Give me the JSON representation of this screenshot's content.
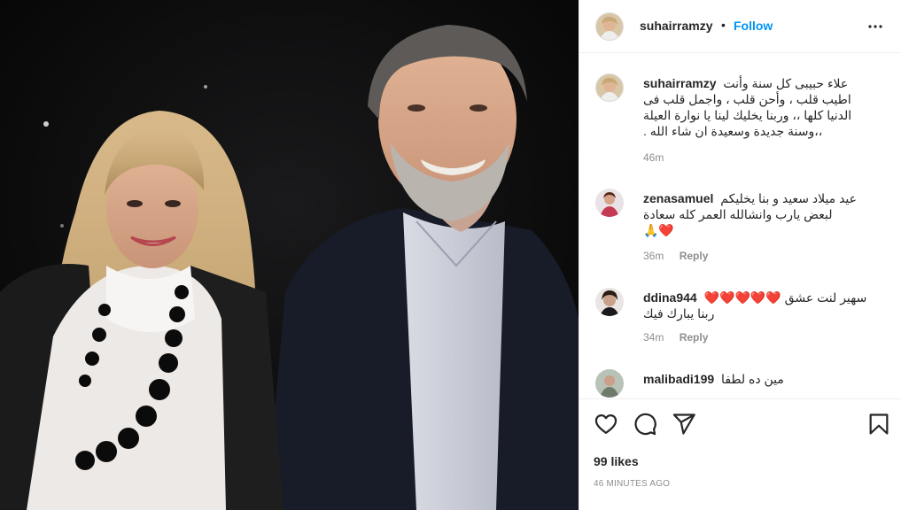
{
  "post": {
    "image_alt": "Photo of a woman and a man smiling"
  },
  "header": {
    "username": "suhairramzy",
    "separator": "•",
    "follow_label": "Follow",
    "more_icon": "more-horizontal-icon"
  },
  "caption": {
    "username": "suhairramzy",
    "text_line1": "علاء حبيبى كل سنة وأنت",
    "text_line2": "اطيب قلب ، وأحن قلب ، واجمل قلب فى",
    "text_line3": "الدنيا كلها ،، وربنا يخليك لينا يا نوارة العيلة",
    "text_line4": "،،وسنة جديدة وسعيدة ان شاء الله .",
    "age": "46m"
  },
  "comments": [
    {
      "username": "zenasamuel",
      "line1": "عيد ميلاد سعيد و بنا يخليكم",
      "line2": "لبعض يارب وانشالله العمر كله سعادة",
      "emoji_line": "🙏❤️",
      "age": "36m",
      "reply_label": "Reply"
    },
    {
      "username": "ddina944",
      "line1": "سهير لنت عشق",
      "hearts": "❤️❤️❤️❤️❤️",
      "line2": "ربنا يبارك فيك",
      "age": "34m",
      "reply_label": "Reply"
    },
    {
      "username": "malibadi199",
      "line1": "مين ده لطفا"
    }
  ],
  "actions": {
    "like_icon": "heart-icon",
    "comment_icon": "comment-icon",
    "share_icon": "share-icon",
    "save_icon": "bookmark-icon"
  },
  "likes": "99 likes",
  "timestamp": "46 MINUTES AGO"
}
